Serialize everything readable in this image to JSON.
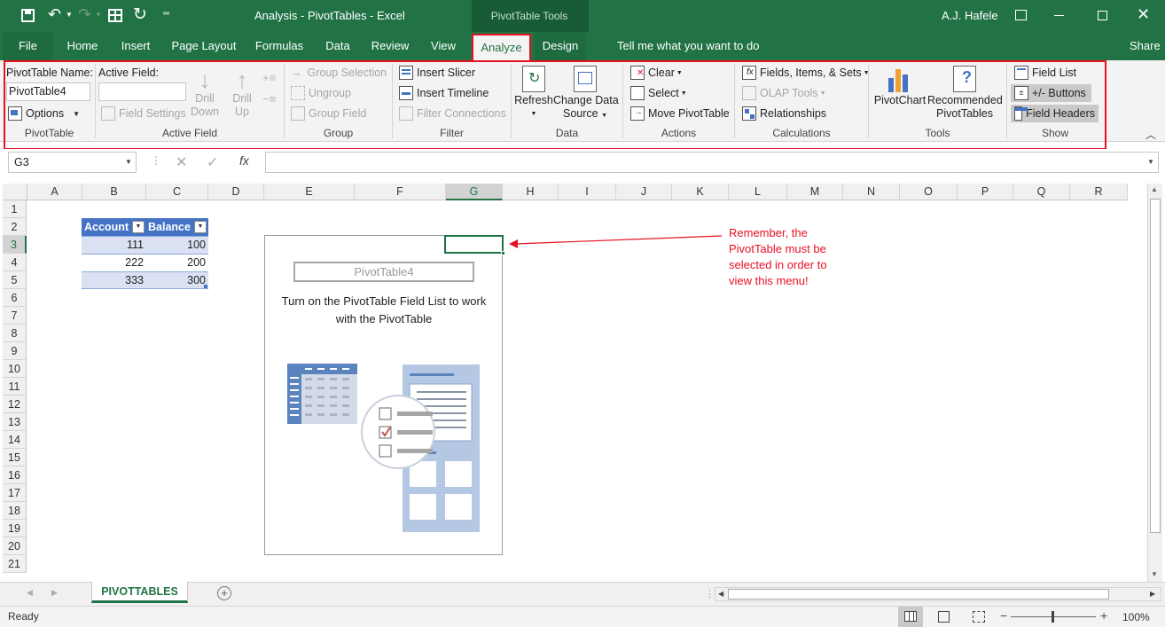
{
  "window": {
    "doc_title": "Analysis - PivotTables - Excel",
    "context_label": "PivotTable Tools",
    "user": "A.J. Hafele"
  },
  "tabs": {
    "file": "File",
    "home": "Home",
    "insert": "Insert",
    "page_layout": "Page Layout",
    "formulas": "Formulas",
    "data": "Data",
    "review": "Review",
    "view": "View",
    "analyze": "Analyze",
    "design": "Design",
    "tell_me": "Tell me what you want to do",
    "share": "Share"
  },
  "ribbon": {
    "pivottable": {
      "name_label": "PivotTable Name:",
      "name_value": "PivotTable4",
      "options": "Options",
      "group": "PivotTable"
    },
    "active_field": {
      "label": "Active Field:",
      "field_settings": "Field Settings",
      "drill_down_1": "Drill",
      "drill_down_2": "Down",
      "drill_up_1": "Drill",
      "drill_up_2": "Up",
      "group": "Active Field"
    },
    "group": {
      "group_selection": "Group Selection",
      "ungroup": "Ungroup",
      "group_field": "Group Field",
      "group": "Group"
    },
    "filter": {
      "insert_slicer": "Insert Slicer",
      "insert_timeline": "Insert Timeline",
      "filter_connections": "Filter Connections",
      "group": "Filter"
    },
    "data": {
      "refresh": "Refresh",
      "change_1": "Change Data",
      "change_2": "Source",
      "group": "Data"
    },
    "actions": {
      "clear": "Clear",
      "select": "Select",
      "move": "Move PivotTable",
      "group": "Actions"
    },
    "calculations": {
      "fields": "Fields, Items, & Sets",
      "olap": "OLAP Tools",
      "relationships": "Relationships",
      "group": "Calculations"
    },
    "tools": {
      "pivotchart": "PivotChart",
      "rec_1": "Recommended",
      "rec_2": "PivotTables",
      "group": "Tools"
    },
    "show": {
      "field_list": "Field List",
      "buttons": "+/- Buttons",
      "headers": "Field Headers",
      "group": "Show"
    }
  },
  "formula": {
    "name_box": "G3",
    "fx": "fx",
    "content": ""
  },
  "grid": {
    "columns": [
      "A",
      "B",
      "C",
      "D",
      "E",
      "F",
      "G",
      "H",
      "I",
      "J",
      "K",
      "L",
      "M",
      "N",
      "O",
      "P",
      "Q",
      "R"
    ],
    "rows": [
      "1",
      "2",
      "3",
      "4",
      "5",
      "6",
      "7",
      "8",
      "9",
      "10",
      "11",
      "12",
      "13",
      "14",
      "15",
      "16",
      "17",
      "18",
      "19",
      "20",
      "21"
    ],
    "table_headers": [
      "Account",
      "Balance"
    ],
    "table_rows": [
      [
        "111",
        "100"
      ],
      [
        "222",
        "200"
      ],
      [
        "333",
        "300"
      ]
    ],
    "pivot_placeholder": {
      "name": "PivotTable4",
      "line1": "Turn on the PivotTable Field List to work",
      "line2": "with the PivotTable"
    },
    "annotation": [
      "Remember, the",
      "PivotTable must be",
      "selected in order to",
      "view this menu!"
    ]
  },
  "sheet_tab": "PIVOTTABLES",
  "status": {
    "ready": "Ready",
    "zoom": "100%"
  },
  "colors": {
    "excel_green": "#217346",
    "annotation_red": "#e81123",
    "table_blue": "#4472c4",
    "table_band": "#d9e1f2"
  }
}
